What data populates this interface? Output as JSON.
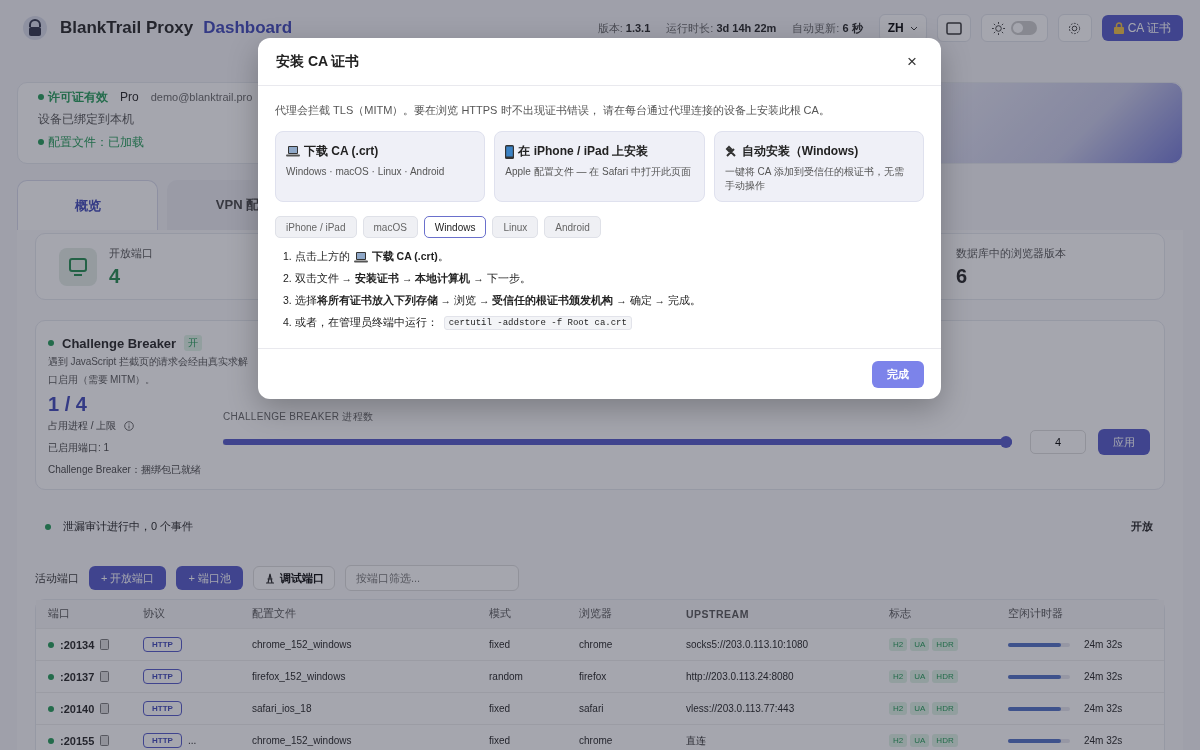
{
  "header": {
    "brand": "BlankTrail Proxy",
    "subtitle": "Dashboard",
    "meta": [
      {
        "label": "版本:",
        "value": "1.3.1"
      },
      {
        "label": "运行时长:",
        "value": "3d 14h 22m"
      },
      {
        "label": "自动更新:",
        "value": "6 秒"
      }
    ],
    "language": "ZH",
    "theme_dark": false,
    "ca_button": "CA 证书"
  },
  "license": {
    "status": "许可证有效",
    "plan": "Pro",
    "email": "demo@blanktrail.pro",
    "bound": "设备已绑定到本机",
    "config": "配置文件：已加载"
  },
  "tabs": [
    {
      "label": "概览",
      "selected": true
    },
    {
      "label": "VPN 配",
      "selected": false
    }
  ],
  "stats": [
    {
      "label": "开放端口",
      "value": "4"
    },
    {
      "label": "数据库中的浏览器版本",
      "value": "6"
    }
  ],
  "challenge": {
    "title": "Challenge Breaker",
    "badge": "开",
    "description": [
      "遇到 JavaScript 拦截页的请求会经由真实求解",
      "口启用（需要 MITM）。"
    ],
    "usage": "1 / 4",
    "usage_label": "占用进程 / 上限",
    "enabled_ports": "已启用端口: 1",
    "bundle": "Challenge Breaker：捆绑包已就绪",
    "slider_label": "CHALLENGE BREAKER 进程数",
    "level": 1.0,
    "count": "4",
    "apply": "应用"
  },
  "audit": {
    "text": "泄漏审计进行中，0 个事件",
    "action": "开放"
  },
  "toolbar": {
    "label": "活动端口",
    "buttons": [
      {
        "label": "+ 开放端口",
        "kind": "primary"
      },
      {
        "label": "+ 端口池",
        "kind": "primary"
      },
      {
        "label": "调试端口",
        "kind": "debug"
      }
    ],
    "filter_placeholder": "按端口筛选..."
  },
  "table": {
    "columns": [
      "端口",
      "协议",
      "配置文件",
      "模式",
      "浏览器",
      "UPSTREAM",
      "标志",
      "空闲计时器"
    ],
    "rows": [
      {
        "port": ":20134",
        "protocol": "HTTP",
        "extra": "",
        "profile": "chrome_152_windows",
        "mode": "fixed",
        "browser": "chrome",
        "upstream": "socks5://203.0.113.10:1080",
        "flags": [
          "H2",
          "UA",
          "HDR"
        ],
        "level": 0.85,
        "idle": "24m 32s"
      },
      {
        "port": ":20137",
        "protocol": "HTTP",
        "extra": "",
        "profile": "firefox_152_windows",
        "mode": "random",
        "browser": "firefox",
        "upstream": "http://203.0.113.24:8080",
        "flags": [
          "H2",
          "UA",
          "HDR"
        ],
        "level": 0.85,
        "idle": "24m 32s"
      },
      {
        "port": ":20140",
        "protocol": "HTTP",
        "extra": "",
        "profile": "safari_ios_18",
        "mode": "fixed",
        "browser": "safari",
        "upstream": "vless://203.0.113.77:443",
        "flags": [
          "H2",
          "UA",
          "HDR"
        ],
        "level": 0.85,
        "idle": "24m 32s"
      },
      {
        "port": ":20155",
        "protocol": "HTTP",
        "extra": "...",
        "profile": "chrome_152_windows",
        "mode": "fixed",
        "browser": "chrome",
        "upstream": "直连",
        "flags": [
          "H2",
          "UA",
          "HDR"
        ],
        "level": 0.85,
        "idle": "24m 32s"
      }
    ]
  },
  "modal": {
    "title": "安装 CA 证书",
    "close": "×",
    "intro": "代理会拦截 TLS（MITM）。要在浏览 HTTPS 时不出现证书错误， 请在每台通过代理连接的设备上安装此根 CA。",
    "options": [
      {
        "title": "下载 CA (.crt)",
        "desc": "Windows · macOS · Linux · Android"
      },
      {
        "title": "在 iPhone / iPad 上安装",
        "desc": "Apple 配置文件 — 在 Safari 中打开此页面"
      },
      {
        "title": "自动安装（Windows)",
        "desc": "一键将 CA 添加到受信任的根证书，无需手动操作"
      }
    ],
    "platforms": [
      {
        "label": "iPhone / iPad",
        "selected": false
      },
      {
        "label": "macOS",
        "selected": false
      },
      {
        "label": "Windows",
        "selected": true
      },
      {
        "label": "Linux",
        "selected": false
      },
      {
        "label": "Android",
        "selected": false
      }
    ],
    "steps": [
      {
        "text": "1. 点击上方的",
        "tail": "**下载 CA (.crt)**。"
      },
      {
        "text": "2. 双击文件 → **安装证书** → **本地计算机** → 下一步。"
      },
      {
        "text": "3. 选择**将所有证书放入下列存储** → 浏览 → **受信任的根证书颁发机构** → 确定 → 完成。"
      },
      {
        "text": "4. 或者，在管理员终端中运行：",
        "code": "certutil -addstore -f Root ca.crt"
      }
    ],
    "done": "完成"
  }
}
